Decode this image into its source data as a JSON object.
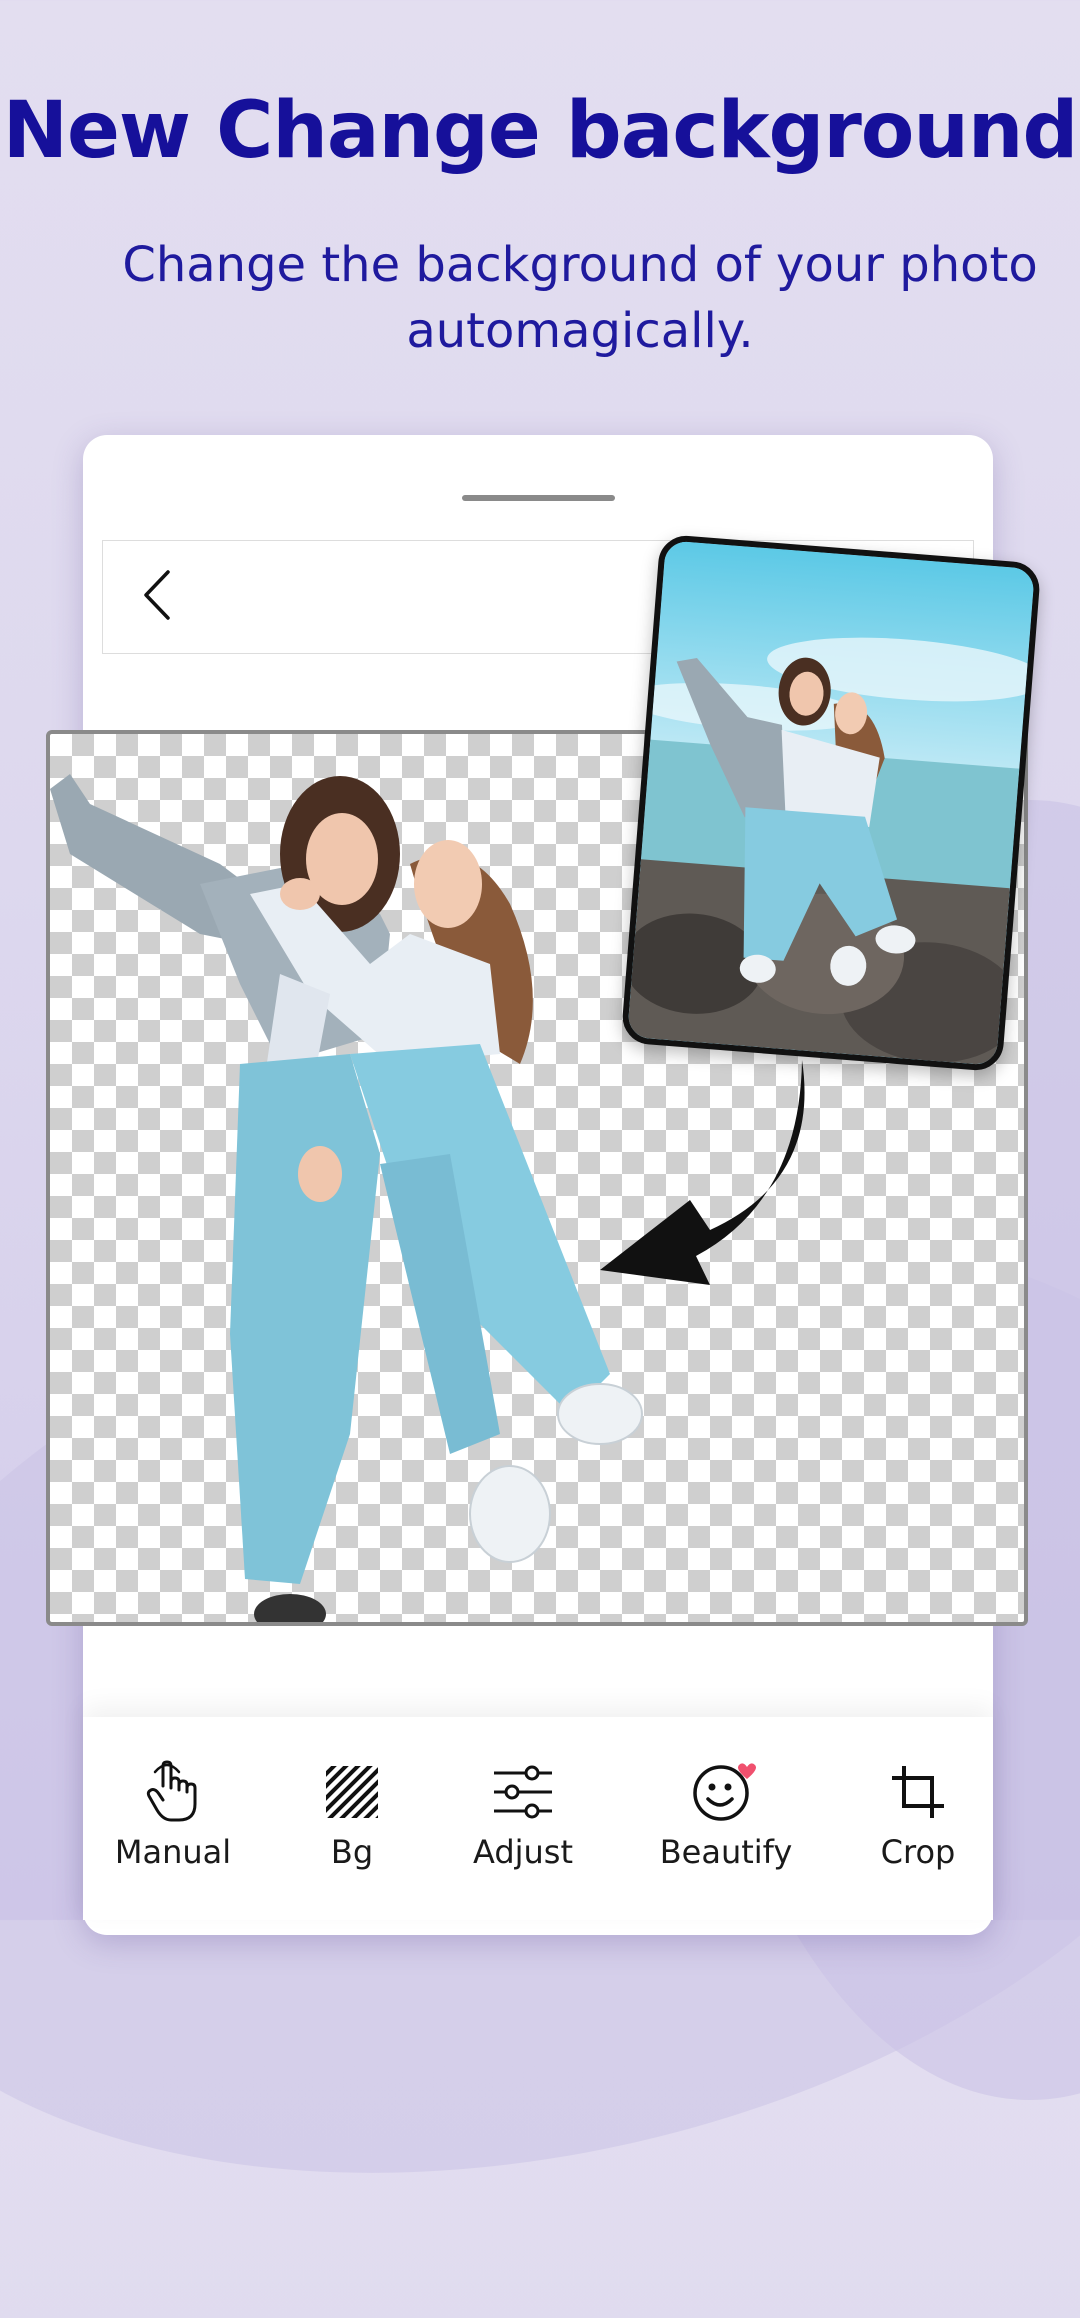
{
  "headline": "New Change background",
  "subline": "Change the background of your photo automagically.",
  "toolbar": {
    "items": [
      {
        "label": "Manual",
        "icon": "hand-tap-icon"
      },
      {
        "label": "Bg",
        "icon": "hatch-pattern-icon"
      },
      {
        "label": "Adjust",
        "icon": "sliders-icon"
      },
      {
        "label": "Beautify",
        "icon": "smiley-heart-icon"
      },
      {
        "label": "Crop",
        "icon": "crop-icon"
      }
    ]
  },
  "colors": {
    "headline": "#16109a",
    "subline": "#1f1a9e",
    "background": "#e3def0",
    "heart_badge": "#f0506e"
  }
}
